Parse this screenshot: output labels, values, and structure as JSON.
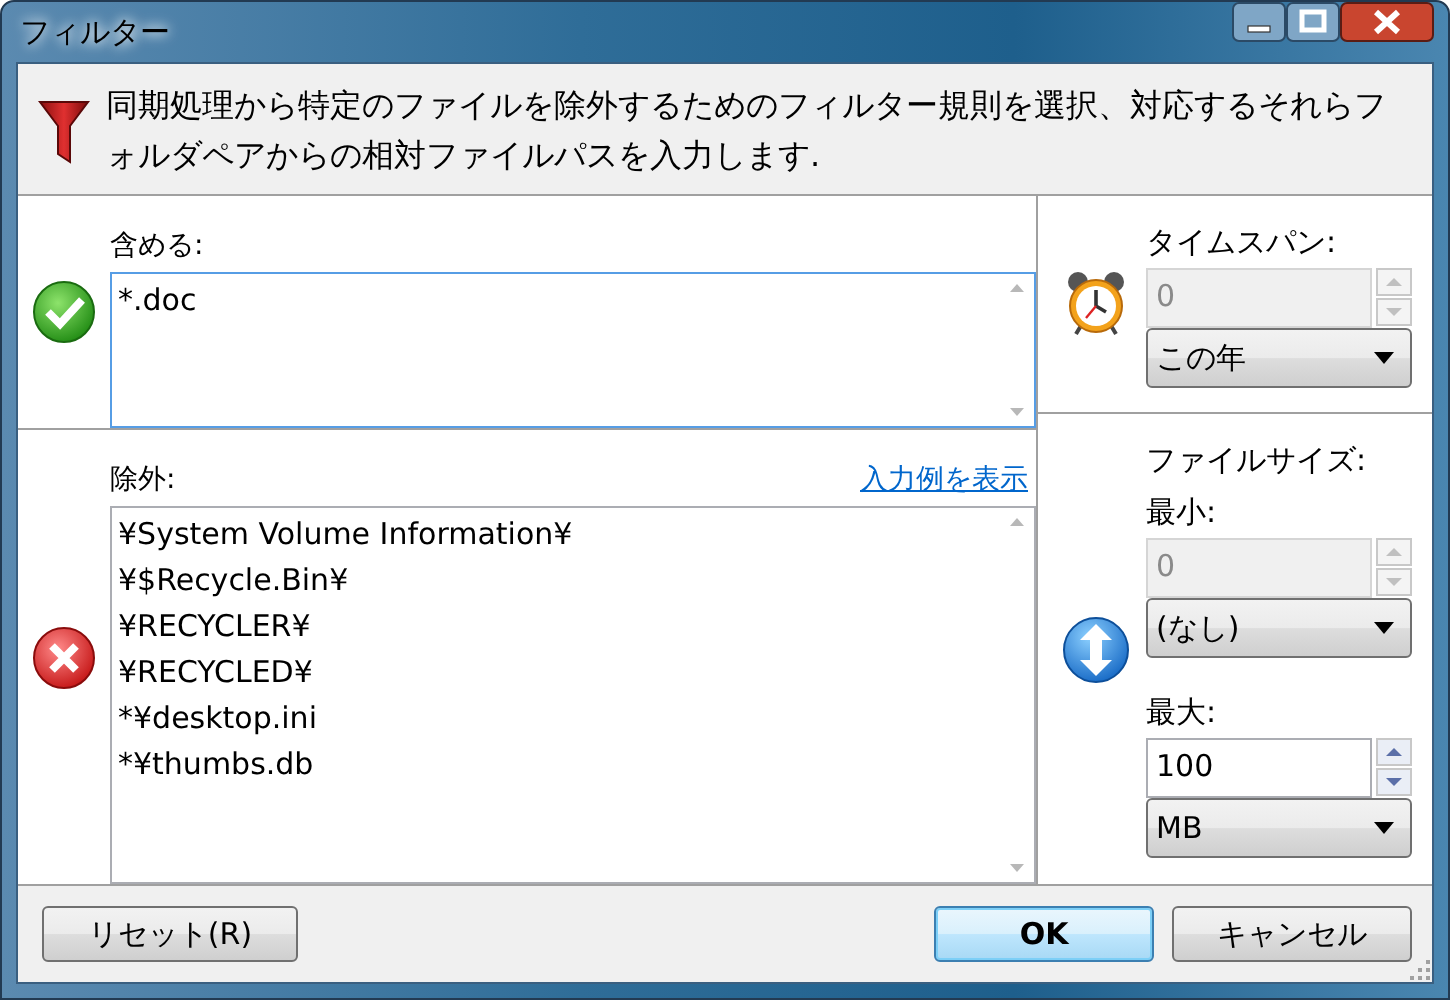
{
  "window": {
    "title": "フィルター"
  },
  "description": "同期処理から特定のファイルを除外するためのフィルター規則を選択、対応するそれらフォルダペアからの相対ファイルパスを入力します.",
  "include": {
    "label": "含める:",
    "lines": [
      "*.doc"
    ]
  },
  "exclude": {
    "label": "除外:",
    "link": "入力例を表示",
    "lines": [
      "¥System Volume Information¥",
      "¥$Recycle.Bin¥",
      "¥RECYCLER¥",
      "¥RECYCLED¥",
      "*¥desktop.ini",
      "*¥thumbs.db"
    ]
  },
  "timespan": {
    "label": "タイムスパン:",
    "value": "0",
    "disabled": true,
    "unit": "この年"
  },
  "filesize": {
    "label": "ファイルサイズ:",
    "min": {
      "label": "最小:",
      "value": "0",
      "disabled": true,
      "unit": "(なし)"
    },
    "max": {
      "label": "最大:",
      "value": "100",
      "disabled": false,
      "unit": "MB"
    }
  },
  "buttons": [
    {
      "label": "リセット(R)",
      "default": false
    },
    {
      "label": "OK",
      "default": true
    },
    {
      "label": "キャンセル",
      "default": false
    }
  ]
}
